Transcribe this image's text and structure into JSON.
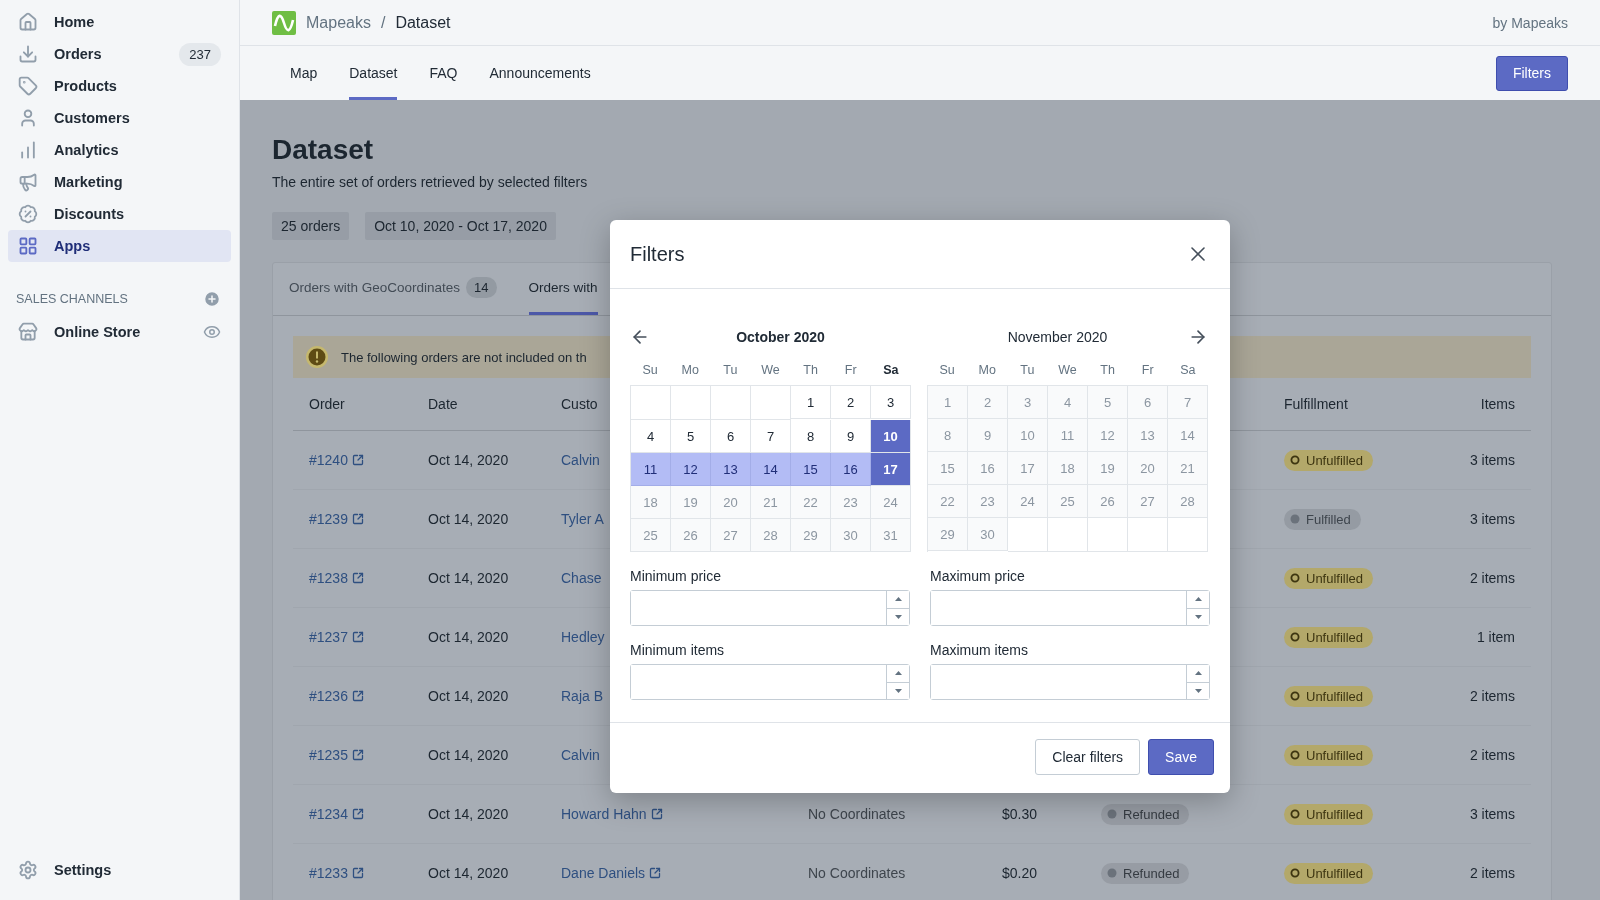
{
  "sidebar": {
    "items": [
      {
        "label": "Home",
        "selected": false
      },
      {
        "label": "Orders",
        "selected": false,
        "badge": "237"
      },
      {
        "label": "Products",
        "selected": false
      },
      {
        "label": "Customers",
        "selected": false
      },
      {
        "label": "Analytics",
        "selected": false
      },
      {
        "label": "Marketing",
        "selected": false
      },
      {
        "label": "Discounts",
        "selected": false
      },
      {
        "label": "Apps",
        "selected": true
      }
    ],
    "section_title": "SALES CHANNELS",
    "channels": [
      {
        "label": "Online Store"
      }
    ],
    "settings": "Settings"
  },
  "header": {
    "breadcrumb": [
      "Mapeaks",
      "Dataset"
    ],
    "separator": "/",
    "by_line": "by Mapeaks"
  },
  "nav_tabs": [
    {
      "label": "Map",
      "selected": false
    },
    {
      "label": "Dataset",
      "selected": true
    },
    {
      "label": "FAQ",
      "selected": false
    },
    {
      "label": "Announcements",
      "selected": false
    }
  ],
  "filters_button": "Filters",
  "page": {
    "title": "Dataset",
    "subtitle": "The entire set of orders retrieved by selected filters",
    "tags": [
      "25 orders",
      "Oct 10, 2020 - Oct 17, 2020"
    ]
  },
  "card_tabs": [
    {
      "label": "Orders with GeoCoordinates",
      "count": "14",
      "selected": false
    },
    {
      "label": "Orders with",
      "selected": true
    }
  ],
  "banner": "The following orders are not included on th",
  "table": {
    "columns": [
      "Order",
      "Date",
      "Custo",
      "Fulfillment",
      "Items"
    ],
    "rows": [
      {
        "order": "#1240",
        "date": "Oct 14, 2020",
        "customer": "Calvin",
        "fulfillment": {
          "label": "Unfulfilled",
          "kind": "unfulfilled"
        },
        "items": "3 items"
      },
      {
        "order": "#1239",
        "date": "Oct 14, 2020",
        "customer": "Tyler A",
        "fulfillment": {
          "label": "Fulfilled",
          "kind": "fulfilled"
        },
        "items": "3 items"
      },
      {
        "order": "#1238",
        "date": "Oct 14, 2020",
        "customer": "Chase",
        "fulfillment": {
          "label": "Unfulfilled",
          "kind": "unfulfilled"
        },
        "items": "2 items"
      },
      {
        "order": "#1237",
        "date": "Oct 14, 2020",
        "customer": "Hedley",
        "fulfillment": {
          "label": "Unfulfilled",
          "kind": "unfulfilled"
        },
        "items": "1 item"
      },
      {
        "order": "#1236",
        "date": "Oct 14, 2020",
        "customer": "Raja B",
        "fulfillment": {
          "label": "Unfulfilled",
          "kind": "unfulfilled"
        },
        "items": "2 items"
      },
      {
        "order": "#1235",
        "date": "Oct 14, 2020",
        "customer": "Calvin",
        "fulfillment": {
          "label": "Unfulfilled",
          "kind": "unfulfilled"
        },
        "items": "2 items"
      },
      {
        "order": "#1234",
        "date": "Oct 14, 2020",
        "customer": "Howard Hahn",
        "external": true,
        "coordinates": "No Coordinates",
        "price": "$0.30",
        "payment": {
          "label": "Refunded",
          "kind": "refunded"
        },
        "fulfillment": {
          "label": "Unfulfilled",
          "kind": "unfulfilled"
        },
        "items": "3 items"
      },
      {
        "order": "#1233",
        "date": "Oct 14, 2020",
        "customer": "Dane Daniels",
        "external": true,
        "coordinates": "No Coordinates",
        "price": "$0.20",
        "payment": {
          "label": "Refunded",
          "kind": "refunded"
        },
        "fulfillment": {
          "label": "Unfulfilled",
          "kind": "unfulfilled"
        },
        "items": "2 items"
      }
    ]
  },
  "modal": {
    "title": "Filters",
    "months": [
      {
        "title": "October 2020",
        "emphasized": true,
        "weekdays": [
          {
            "label": "Su",
            "bold": false
          },
          {
            "label": "Mo",
            "bold": false
          },
          {
            "label": "Tu",
            "bold": false
          },
          {
            "label": "We",
            "bold": false
          },
          {
            "label": "Th",
            "bold": false
          },
          {
            "label": "Fr",
            "bold": false
          },
          {
            "label": "Sa",
            "bold": true
          }
        ],
        "weeks": [
          [
            {
              "day": "1",
              "selected": false,
              "in_range": false,
              "disabled": false
            },
            {
              "day": "2",
              "selected": false,
              "in_range": false,
              "disabled": false
            },
            {
              "day": "3",
              "selected": false,
              "in_range": false,
              "disabled": false
            }
          ],
          [
            {
              "day": "4",
              "selected": false,
              "in_range": false,
              "disabled": false
            },
            {
              "day": "5",
              "selected": false,
              "in_range": false,
              "disabled": false
            },
            {
              "day": "6",
              "selected": false,
              "in_range": false,
              "disabled": false
            },
            {
              "day": "7",
              "selected": false,
              "in_range": false,
              "disabled": false
            },
            {
              "day": "8",
              "selected": false,
              "in_range": false,
              "disabled": false
            },
            {
              "day": "9",
              "selected": false,
              "in_range": false,
              "disabled": false
            },
            {
              "day": "10",
              "selected": true,
              "in_range": false,
              "disabled": false
            }
          ],
          [
            {
              "day": "11",
              "selected": false,
              "in_range": true,
              "disabled": false
            },
            {
              "day": "12",
              "selected": false,
              "in_range": true,
              "disabled": false
            },
            {
              "day": "13",
              "selected": false,
              "in_range": true,
              "disabled": false
            },
            {
              "day": "14",
              "selected": false,
              "in_range": true,
              "disabled": false
            },
            {
              "day": "15",
              "selected": false,
              "in_range": true,
              "disabled": false
            },
            {
              "day": "16",
              "selected": false,
              "in_range": true,
              "disabled": false
            },
            {
              "day": "17",
              "selected": true,
              "in_range": false,
              "disabled": false
            }
          ],
          [
            {
              "day": "18",
              "selected": false,
              "in_range": false,
              "disabled": true
            },
            {
              "day": "19",
              "selected": false,
              "in_range": false,
              "disabled": true
            },
            {
              "day": "20",
              "selected": false,
              "in_range": false,
              "disabled": true
            },
            {
              "day": "21",
              "selected": false,
              "in_range": false,
              "disabled": true
            },
            {
              "day": "22",
              "selected": false,
              "in_range": false,
              "disabled": true
            },
            {
              "day": "23",
              "selected": false,
              "in_range": false,
              "disabled": true
            },
            {
              "day": "24",
              "selected": false,
              "in_range": false,
              "disabled": true
            }
          ],
          [
            {
              "day": "25",
              "selected": false,
              "in_range": false,
              "disabled": true
            },
            {
              "day": "26",
              "selected": false,
              "in_range": false,
              "disabled": true
            },
            {
              "day": "27",
              "selected": false,
              "in_range": false,
              "disabled": true
            },
            {
              "day": "28",
              "selected": false,
              "in_range": false,
              "disabled": true
            },
            {
              "day": "29",
              "selected": false,
              "in_range": false,
              "disabled": true
            },
            {
              "day": "30",
              "selected": false,
              "in_range": false,
              "disabled": true
            },
            {
              "day": "31",
              "selected": false,
              "in_range": false,
              "disabled": true
            }
          ]
        ]
      },
      {
        "title": "November 2020",
        "emphasized": false,
        "weekdays": [
          {
            "label": "Su",
            "bold": false
          },
          {
            "label": "Mo",
            "bold": false
          },
          {
            "label": "Tu",
            "bold": false
          },
          {
            "label": "We",
            "bold": false
          },
          {
            "label": "Th",
            "bold": false
          },
          {
            "label": "Fr",
            "bold": false
          },
          {
            "label": "Sa",
            "bold": false
          }
        ],
        "weeks": [
          [
            {
              "day": "1",
              "selected": false,
              "in_range": false,
              "disabled": true
            },
            {
              "day": "2",
              "selected": false,
              "in_range": false,
              "disabled": true
            },
            {
              "day": "3",
              "selected": false,
              "in_range": false,
              "disabled": true
            },
            {
              "day": "4",
              "selected": false,
              "in_range": false,
              "disabled": true
            },
            {
              "day": "5",
              "selected": false,
              "in_range": false,
              "disabled": true
            },
            {
              "day": "6",
              "selected": false,
              "in_range": false,
              "disabled": true
            },
            {
              "day": "7",
              "selected": false,
              "in_range": false,
              "disabled": true
            }
          ],
          [
            {
              "day": "8",
              "selected": false,
              "in_range": false,
              "disabled": true
            },
            {
              "day": "9",
              "selected": false,
              "in_range": false,
              "disabled": true
            },
            {
              "day": "10",
              "selected": false,
              "in_range": false,
              "disabled": true
            },
            {
              "day": "11",
              "selected": false,
              "in_range": false,
              "disabled": true
            },
            {
              "day": "12",
              "selected": false,
              "in_range": false,
              "disabled": true
            },
            {
              "day": "13",
              "selected": false,
              "in_range": false,
              "disabled": true
            },
            {
              "day": "14",
              "selected": false,
              "in_range": false,
              "disabled": true
            }
          ],
          [
            {
              "day": "15",
              "selected": false,
              "in_range": false,
              "disabled": true
            },
            {
              "day": "16",
              "selected": false,
              "in_range": false,
              "disabled": true
            },
            {
              "day": "17",
              "selected": false,
              "in_range": false,
              "disabled": true
            },
            {
              "day": "18",
              "selected": false,
              "in_range": false,
              "disabled": true
            },
            {
              "day": "19",
              "selected": false,
              "in_range": false,
              "disabled": true
            },
            {
              "day": "20",
              "selected": false,
              "in_range": false,
              "disabled": true
            },
            {
              "day": "21",
              "selected": false,
              "in_range": false,
              "disabled": true
            }
          ],
          [
            {
              "day": "22",
              "selected": false,
              "in_range": false,
              "disabled": true
            },
            {
              "day": "23",
              "selected": false,
              "in_range": false,
              "disabled": true
            },
            {
              "day": "24",
              "selected": false,
              "in_range": false,
              "disabled": true
            },
            {
              "day": "25",
              "selected": false,
              "in_range": false,
              "disabled": true
            },
            {
              "day": "26",
              "selected": false,
              "in_range": false,
              "disabled": true
            },
            {
              "day": "27",
              "selected": false,
              "in_range": false,
              "disabled": true
            },
            {
              "day": "28",
              "selected": false,
              "in_range": false,
              "disabled": true
            }
          ],
          [
            {
              "day": "29",
              "selected": false,
              "in_range": false,
              "disabled": true
            },
            {
              "day": "30",
              "selected": false,
              "in_range": false,
              "disabled": true
            }
          ]
        ]
      }
    ],
    "fields": [
      {
        "label": "Minimum price"
      },
      {
        "label": "Maximum price"
      },
      {
        "label": "Minimum items"
      },
      {
        "label": "Maximum items"
      }
    ],
    "buttons": [
      {
        "label": "Clear filters",
        "kind": "secondary"
      },
      {
        "label": "Save",
        "kind": "primary"
      }
    ]
  }
}
